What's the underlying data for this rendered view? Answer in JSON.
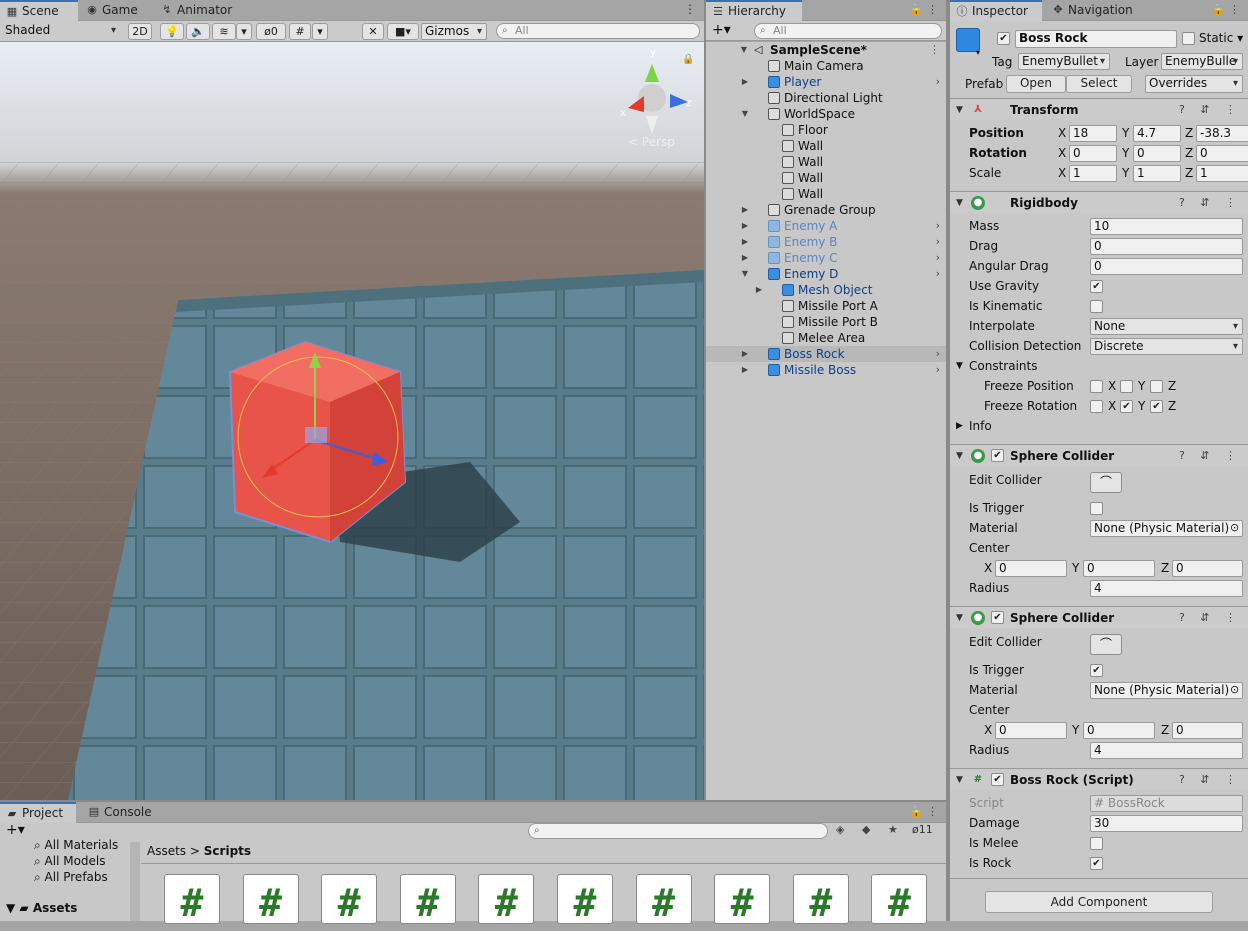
{
  "scene_tabs": [
    {
      "label": "Scene",
      "icon": "grid-icon"
    },
    {
      "label": "Game",
      "icon": "gamepad-icon"
    },
    {
      "label": "Animator",
      "icon": "animator-icon"
    }
  ],
  "scene_toolbar": {
    "shading": "Shaded",
    "mode_2d": "2D",
    "hidden_count": "0",
    "gizmos": "Gizmos",
    "search_placeholder": "All"
  },
  "gizmo": {
    "y": "y",
    "x": "x",
    "z": "z",
    "persp": "< Persp"
  },
  "hierarchy": {
    "tab": "Hierarchy",
    "search_placeholder": "All",
    "scene_name": "SampleScene*",
    "items": [
      {
        "label": "Main Camera",
        "depth": 1,
        "arrow": "",
        "kind": "obj"
      },
      {
        "label": "Player",
        "depth": 1,
        "arrow": "▶",
        "kind": "prefab",
        "more": true
      },
      {
        "label": "Directional Light",
        "depth": 1,
        "arrow": "",
        "kind": "obj"
      },
      {
        "label": "WorldSpace",
        "depth": 1,
        "arrow": "▼",
        "kind": "obj"
      },
      {
        "label": "Floor",
        "depth": 2,
        "arrow": "",
        "kind": "obj"
      },
      {
        "label": "Wall",
        "depth": 2,
        "arrow": "",
        "kind": "obj"
      },
      {
        "label": "Wall",
        "depth": 2,
        "arrow": "",
        "kind": "obj"
      },
      {
        "label": "Wall",
        "depth": 2,
        "arrow": "",
        "kind": "obj"
      },
      {
        "label": "Wall",
        "depth": 2,
        "arrow": "",
        "kind": "obj"
      },
      {
        "label": "Grenade Group",
        "depth": 1,
        "arrow": "▶",
        "kind": "obj"
      },
      {
        "label": "Enemy A",
        "depth": 1,
        "arrow": "▶",
        "kind": "faded",
        "more": true
      },
      {
        "label": "Enemy B",
        "depth": 1,
        "arrow": "▶",
        "kind": "faded",
        "more": true
      },
      {
        "label": "Enemy C",
        "depth": 1,
        "arrow": "▶",
        "kind": "faded",
        "more": true
      },
      {
        "label": "Enemy D",
        "depth": 1,
        "arrow": "▼",
        "kind": "prefab",
        "more": true
      },
      {
        "label": "Mesh Object",
        "depth": 2,
        "arrow": "▶",
        "kind": "prefab"
      },
      {
        "label": "Missile Port A",
        "depth": 2,
        "arrow": "",
        "kind": "obj"
      },
      {
        "label": "Missile Port B",
        "depth": 2,
        "arrow": "",
        "kind": "obj"
      },
      {
        "label": "Melee Area",
        "depth": 2,
        "arrow": "",
        "kind": "obj"
      },
      {
        "label": "Boss Rock",
        "depth": 1,
        "arrow": "▶",
        "kind": "prefab-sel",
        "more": true
      },
      {
        "label": "Missile Boss",
        "depth": 1,
        "arrow": "▶",
        "kind": "prefab",
        "more": true
      }
    ]
  },
  "inspector": {
    "tab": "Inspector",
    "tab2": "Navigation",
    "object_name": "Boss Rock",
    "static_label": "Static",
    "tag_label": "Tag",
    "tag_value": "EnemyBullet",
    "layer_label": "Layer",
    "layer_value": "EnemyBulle",
    "prefab_label": "Prefab",
    "open": "Open",
    "select": "Select",
    "overrides": "Overrides",
    "transform": {
      "title": "Transform",
      "position": "Position",
      "rotation": "Rotation",
      "scale": "Scale",
      "pos": [
        "18",
        "4.7",
        "-38.3"
      ],
      "rot": [
        "0",
        "0",
        "0"
      ],
      "scl": [
        "1",
        "1",
        "1"
      ]
    },
    "rigidbody": {
      "title": "Rigidbody",
      "mass_l": "Mass",
      "mass": "10",
      "drag_l": "Drag",
      "drag": "0",
      "adrag_l": "Angular Drag",
      "adrag": "0",
      "gravity_l": "Use Gravity",
      "kinematic_l": "Is Kinematic",
      "interp_l": "Interpolate",
      "interp": "None",
      "coll_l": "Collision Detection",
      "coll": "Discrete",
      "constraints": "Constraints",
      "freeze_pos": "Freeze Position",
      "freeze_rot": "Freeze Rotation",
      "info": "Info"
    },
    "sphere1": {
      "title": "Sphere Collider",
      "edit": "Edit Collider",
      "trigger_l": "Is Trigger",
      "material_l": "Material",
      "material": "None (Physic Material)",
      "center_l": "Center",
      "cx": "0",
      "cy": "0",
      "cz": "0",
      "radius_l": "Radius",
      "radius": "4"
    },
    "sphere2": {
      "title": "Sphere Collider",
      "edit": "Edit Collider",
      "trigger_l": "Is Trigger",
      "material_l": "Material",
      "material": "None (Physic Material)",
      "center_l": "Center",
      "cx": "0",
      "cy": "0",
      "cz": "0",
      "radius_l": "Radius",
      "radius": "4"
    },
    "script": {
      "title": "Boss Rock (Script)",
      "script_l": "Script",
      "script": "BossRock",
      "damage_l": "Damage",
      "damage": "30",
      "melee_l": "Is Melee",
      "rock_l": "Is Rock"
    },
    "add_component": "Add Component"
  },
  "axis": {
    "x": "X",
    "y": "Y",
    "z": "Z"
  },
  "project": {
    "tab": "Project",
    "tab2": "Console",
    "hidden_count": "11",
    "favorites": [
      "All Materials",
      "All Models",
      "All Prefabs"
    ],
    "assets": "Assets",
    "breadcrumb_root": "Assets",
    "breadcrumb_sep": ">",
    "breadcrumb_leaf": "Scripts",
    "thumb_glyph": "#"
  },
  "colors": {
    "accent": "#3a72b0",
    "selection": "#b8b8b8",
    "prefab": "#0c3f8a"
  }
}
